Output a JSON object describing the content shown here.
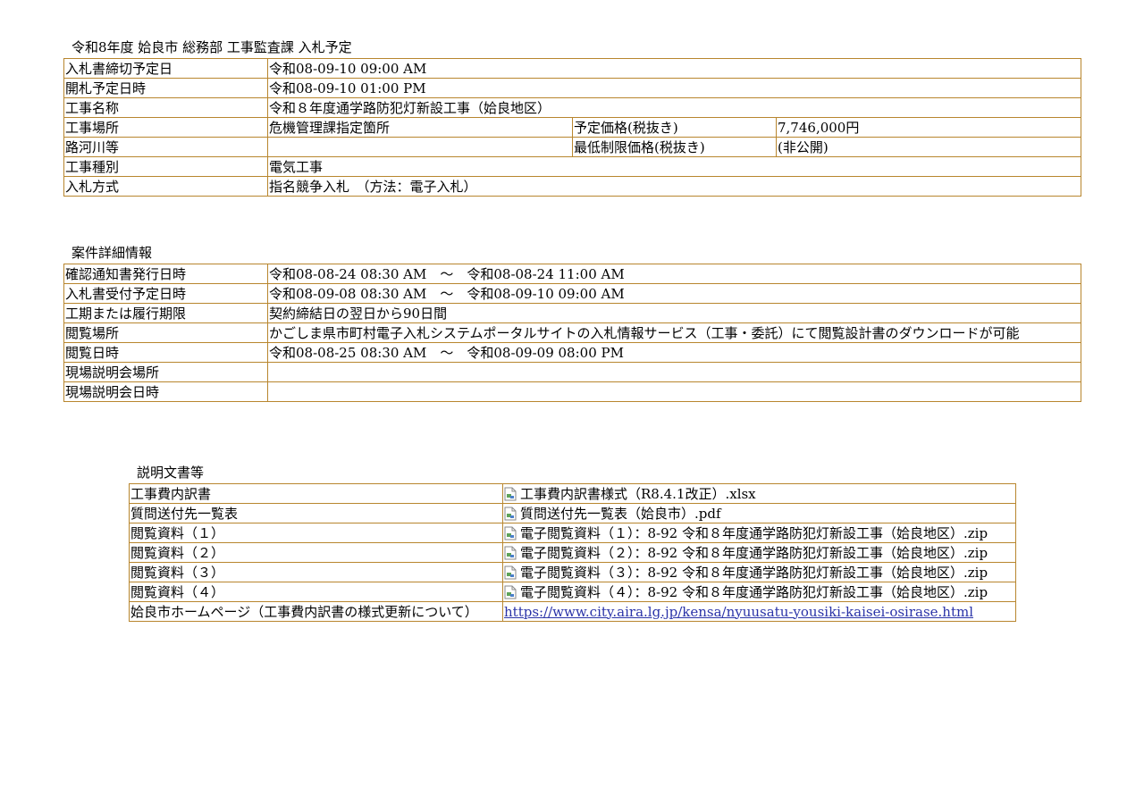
{
  "bid_plan": {
    "caption": "令和8年度  姶良市  総務部  工事監査課  入札予定",
    "rows": {
      "deadline": {
        "label": "入札書締切予定日",
        "value": "令和08-09-10 09:00 AM"
      },
      "opening": {
        "label": "開札予定日時",
        "value": "令和08-09-10 01:00 PM"
      },
      "name": {
        "label": "工事名称",
        "value": "令和８年度通学路防犯灯新設工事（姶良地区）"
      },
      "location": {
        "label": "工事場所",
        "value": "危機管理課指定箇所",
        "sub_label": "予定価格(税抜き)",
        "sub_value": "7,746,000円"
      },
      "river": {
        "label": "路河川等",
        "value": "",
        "sub_label": "最低制限価格(税抜き)",
        "sub_value": "(非公開)"
      },
      "type": {
        "label": "工事種別",
        "value": "電気工事"
      },
      "method": {
        "label": "入札方式",
        "value": "指名競争入札　（方法：電子入札）"
      }
    }
  },
  "details": {
    "caption": "案件詳細情報",
    "rows": {
      "confirm_notice": {
        "label": "確認通知書発行日時",
        "value": "令和08-08-24 08:30 AM　～　令和08-08-24 11:00 AM"
      },
      "bid_reception": {
        "label": "入札書受付予定日時",
        "value": "令和08-09-08 08:30 AM　～　令和08-09-10 09:00 AM"
      },
      "period": {
        "label": "工期または履行期限",
        "value": "契約締結日の翌日から90日間"
      },
      "viewing_place": {
        "label": "閲覧場所",
        "value": "かごしま県市町村電子入札システムポータルサイトの入札情報サービス（工事・委託）にて閲覧設計書のダウンロードが可能"
      },
      "viewing_date": {
        "label": "閲覧日時",
        "value": "令和08-08-25 08:30 AM　～　令和08-09-09 08:00 PM"
      },
      "site_briefing_place": {
        "label": "現場説明会場所",
        "value": ""
      },
      "site_briefing_date": {
        "label": "現場説明会日時",
        "value": ""
      }
    }
  },
  "documents": {
    "caption": "説明文書等",
    "rows": [
      {
        "label": "工事費内訳書",
        "file": "工事費内訳書様式（R8.4.1改正）.xlsx"
      },
      {
        "label": "質問送付先一覧表",
        "file": "質問送付先一覧表（姶良市）.pdf"
      },
      {
        "label": "閲覧資料（１）",
        "file": "電子閲覧資料（１）：8-92 令和８年度通学路防犯灯新設工事（姶良地区）.zip"
      },
      {
        "label": "閲覧資料（２）",
        "file": "電子閲覧資料（２）：8-92 令和８年度通学路防犯灯新設工事（姶良地区）.zip"
      },
      {
        "label": "閲覧資料（３）",
        "file": "電子閲覧資料（３）：8-92 令和８年度通学路防犯灯新設工事（姶良地区）.zip"
      },
      {
        "label": "閲覧資料（４）",
        "file": "電子閲覧資料（４）：8-92 令和８年度通学路防犯灯新設工事（姶良地区）.zip"
      }
    ],
    "homepage": {
      "label": "姶良市ホームページ（工事費内訳書の様式更新について）",
      "url": "https://www.city.aira.lg.jp/kensa/nyuusatu-yousiki-kaisei-osirase.html"
    }
  },
  "icons": {
    "file_icon": "broken-image-icon"
  },
  "colors": {
    "border": "#b8862e",
    "link": "#2a33a8"
  }
}
